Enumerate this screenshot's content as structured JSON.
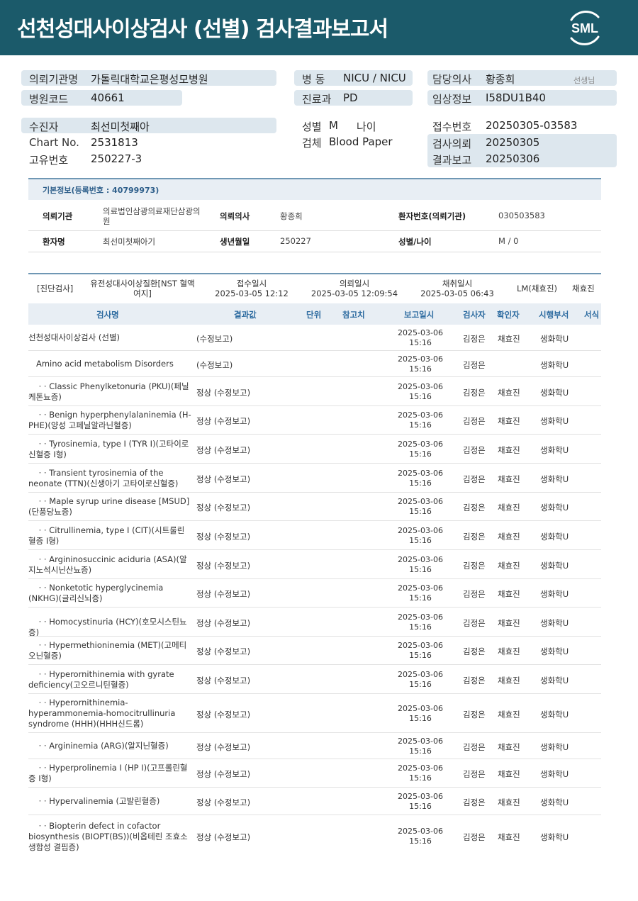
{
  "header": {
    "title": "선천성대사이상검사 (선별) 검사결과보고서",
    "logo_text": "SML",
    "bg_color": "#1b5a6a"
  },
  "patient_header": {
    "institution_label": "의뢰기관명",
    "institution_value": "가톨릭대학교은평성모병원",
    "hospital_code_label": "병원코드",
    "hospital_code_value": "40661",
    "ward_label": "병 동",
    "ward_value": "NICU / NICU",
    "dept_label": "진료과",
    "dept_value": "PD",
    "doctor_label": "담당의사",
    "doctor_value": "황종희",
    "doctor_suffix": "선생님",
    "clinical_label": "임상정보",
    "clinical_value": "I58DU1B40",
    "examinee_label": "수진자",
    "examinee_value": "최선미첫째아",
    "chart_label": "Chart No.",
    "chart_value": "2531813",
    "unique_label": "고유번호",
    "unique_value": "250227-3",
    "sex_label": "성별",
    "sex_value": "M",
    "age_label": "나이",
    "specimen_label": "검체",
    "specimen_value": "Blood Paper",
    "receipt_label": "접수번호",
    "receipt_value": "20250305-03583",
    "request_label": "검사의뢰",
    "request_value": "20250305",
    "report_label": "결과보고",
    "report_value": "20250306"
  },
  "basic_info": {
    "title": "기본정보(등록번호 : 40799973)",
    "inst_label": "의뢰기관",
    "inst_value_line1": "의료법인삼광의료재단삼광의",
    "inst_value_line2": "원",
    "req_doc_label": "의뢰의사",
    "req_doc_value": "황종희",
    "patient_no_label": "환자번호(의뢰기관)",
    "patient_no_value": "030503583",
    "patient_name_label": "환자명",
    "patient_name_value": "최선미첫째아기",
    "birth_label": "생년월일",
    "birth_value": "250227",
    "sex_age_label": "성별/나이",
    "sex_age_value": "M / 0"
  },
  "exam_summary": {
    "category": "[진단검사]",
    "disease_line1": "유전성대사이상질환[NST 혈액",
    "disease_line2": "여지]",
    "receipt_label": "접수일시",
    "receipt_value": "2025-03-05 12:12",
    "request_label": "의뢰일시",
    "request_value": "2025-03-05 12:09:54",
    "collect_label": "채취일시",
    "collect_value": "2025-03-05 06:43",
    "lm_value": "LM(채효진)",
    "person_value": "채효진"
  },
  "table": {
    "headers": [
      "검사명",
      "결과값",
      "단위",
      "참고치",
      "보고일시",
      "검사자",
      "확인자",
      "시행부서",
      "서식"
    ],
    "rows": [
      {
        "name": "선천성대사이상검사 (선별)",
        "result": "(수정보고)",
        "date": "2025-03-06",
        "time": "15:16",
        "tester": "김정은",
        "confirmer": "채효진",
        "dept": "생화학U"
      },
      {
        "name": "   Amino acid metabolism Disorders",
        "result": "(수정보고)",
        "date": "2025-03-06",
        "time": "15:16",
        "tester": "김정은",
        "confirmer": "",
        "dept": "생화학U"
      },
      {
        "name": "    · · Classic Phenylketonuria (PKU)(페닐케톤뇨증)",
        "result": "정상 (수정보고)",
        "date": "2025-03-06",
        "time": "15:16",
        "tester": "김정은",
        "confirmer": "채효진",
        "dept": "생화학U"
      },
      {
        "name": "    · · Benign hyperphenylalaninemia (H-PHE)(양성 고페닐알라닌혈증)",
        "result": "정상 (수정보고)",
        "date": "2025-03-06",
        "time": "15:16",
        "tester": "김정은",
        "confirmer": "채효진",
        "dept": "생화학U"
      },
      {
        "name": "    · · Tyrosinemia, type I (TYR I)(고타이로신혈증 I형)",
        "result": "정상 (수정보고)",
        "date": "2025-03-06",
        "time": "15:16",
        "tester": "김정은",
        "confirmer": "채효진",
        "dept": "생화학U"
      },
      {
        "name": "    · · Transient tyrosinemia of the neonate (TTN)(신생아기 고타이로신혈증)",
        "result": "정상 (수정보고)",
        "date": "2025-03-06",
        "time": "15:16",
        "tester": "김정은",
        "confirmer": "채효진",
        "dept": "생화학U"
      },
      {
        "name": "    · · Maple syrup urine disease [MSUD](단풍당뇨증)",
        "result": "정상 (수정보고)",
        "date": "2025-03-06",
        "time": "15:16",
        "tester": "김정은",
        "confirmer": "채효진",
        "dept": "생화학U"
      },
      {
        "name": "    · · Citrullinemia, type I (CIT)(시트룰린혈증 I형)",
        "result": "정상 (수정보고)",
        "date": "2025-03-06",
        "time": "15:16",
        "tester": "김정은",
        "confirmer": "채효진",
        "dept": "생화학U"
      },
      {
        "name": "    · · Argininosuccinic aciduria (ASA)(알지노석시닌산뇨증)",
        "result": "정상 (수정보고)",
        "date": "2025-03-06",
        "time": "15:16",
        "tester": "김정은",
        "confirmer": "채효진",
        "dept": "생화학U"
      },
      {
        "name": "    · · Nonketotic hyperglycinemia (NKHG)(글리신뇌증)",
        "result": "정상 (수정보고)",
        "date": "2025-03-06",
        "time": "15:16",
        "tester": "김정은",
        "confirmer": "채효진",
        "dept": "생화학U"
      },
      {
        "name": "    · · Homocystinuria (HCY)(호모시스틴뇨증)",
        "result": "정상 (수정보고)",
        "date": "2025-03-06",
        "time": "15:16",
        "tester": "김정은",
        "confirmer": "채효진",
        "dept": "생화학U"
      },
      {
        "name": "    · · Hypermethioninemia (MET)(고메티오닌혈증)",
        "result": "정상 (수정보고)",
        "date": "2025-03-06",
        "time": "15:16",
        "tester": "김정은",
        "confirmer": "채효진",
        "dept": "생화학U"
      },
      {
        "name": "    · · Hyperornithinemia with gyrate deficiency(고오르니틴혈증)",
        "result": "정상 (수정보고)",
        "date": "2025-03-06",
        "time": "15:16",
        "tester": "김정은",
        "confirmer": "채효진",
        "dept": "생화학U"
      },
      {
        "name": "    · · Hyperornithinemia-hyperammonemia-homocitrullinuria syndrome (HHH)(HHH신드롬)",
        "result": "정상 (수정보고)",
        "date": "2025-03-06",
        "time": "15:16",
        "tester": "김정은",
        "confirmer": "채효진",
        "dept": "생화학U"
      },
      {
        "name": "    · · Argininemia (ARG)(알지닌혈증)",
        "result": "정상 (수정보고)",
        "date": "2025-03-06",
        "time": "15:16",
        "tester": "김정은",
        "confirmer": "채효진",
        "dept": "생화학U"
      },
      {
        "name": "    · · Hyperprolinemia I (HP I)(고프롤린혈증 I형)",
        "result": "정상 (수정보고)",
        "date": "2025-03-06",
        "time": "15:16",
        "tester": "김정은",
        "confirmer": "채효진",
        "dept": "생화학U"
      },
      {
        "name": "    · · Hypervalinemia (고발린혈증)",
        "result": "정상 (수정보고)",
        "date": "2025-03-06",
        "time": "15:16",
        "tester": "김정은",
        "confirmer": "채효진",
        "dept": "생화학U"
      },
      {
        "name": "    · · Biopterin defect in cofactor biosynthesis (BIOPT(BS))(비옵테린 조효소 생합성 결핍증)",
        "result": "정상 (수정보고)",
        "date": "2025-03-06",
        "time": "15:16",
        "tester": "김정은",
        "confirmer": "채효진",
        "dept": "생화학U"
      }
    ]
  }
}
